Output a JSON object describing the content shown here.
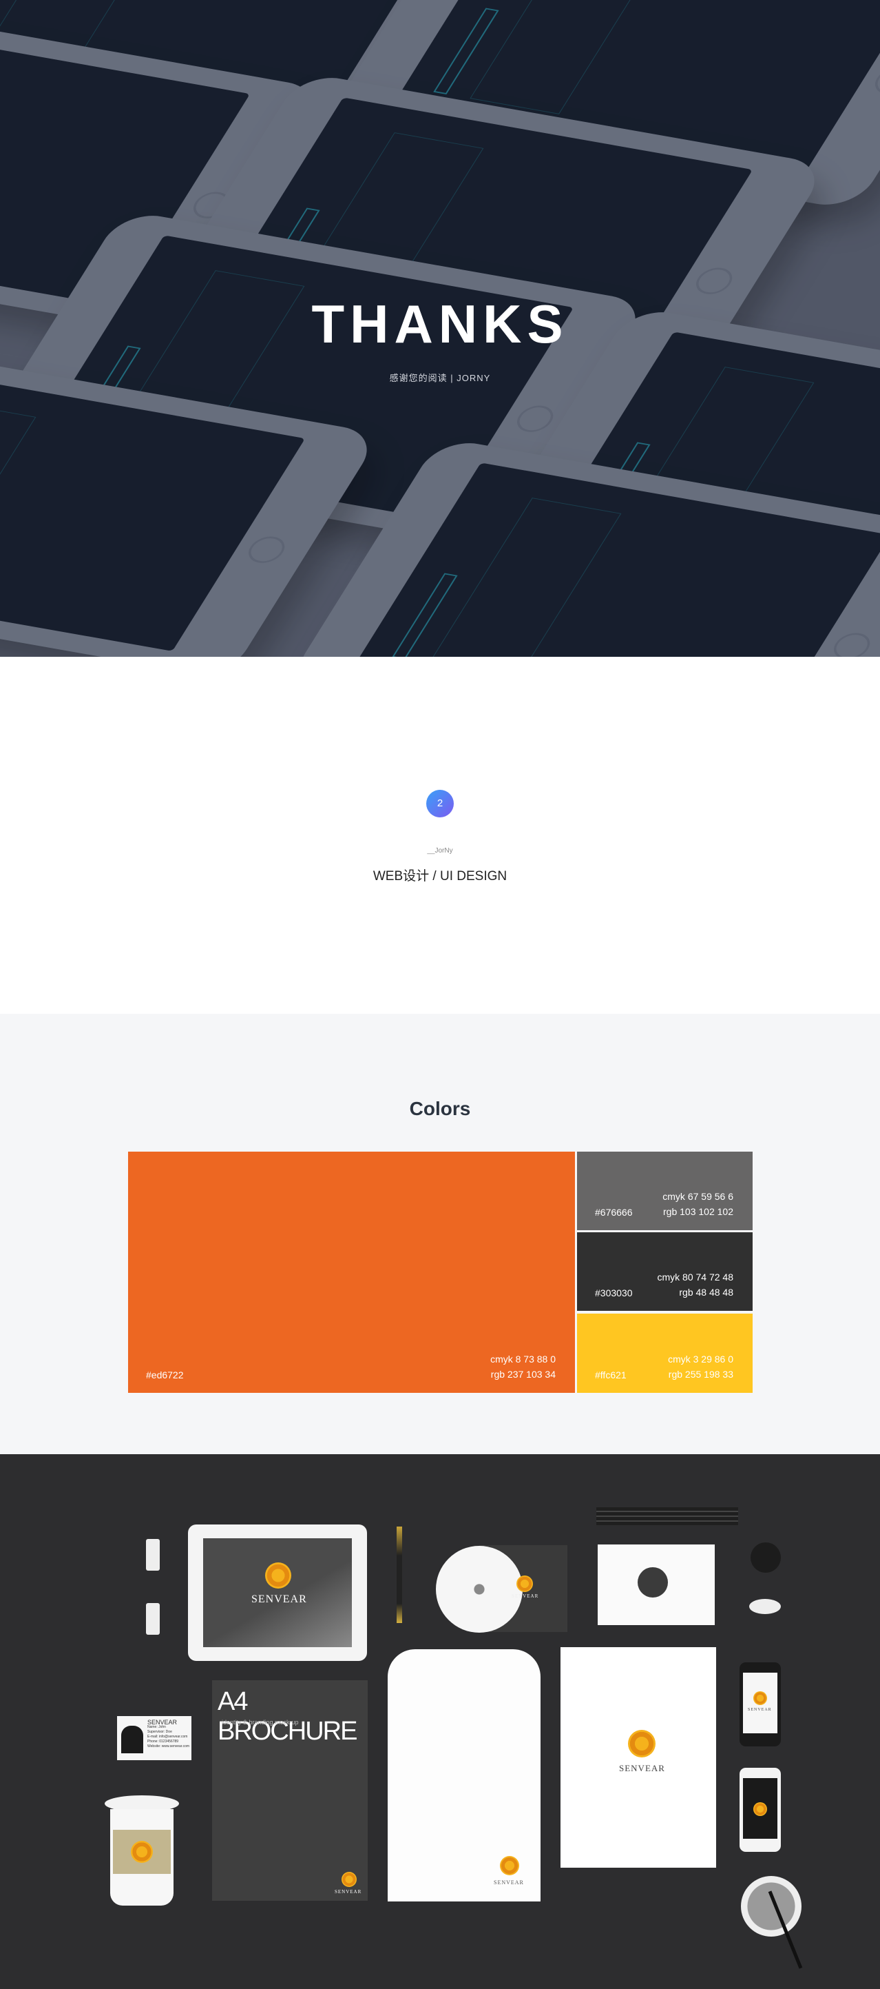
{
  "hero": {
    "title": "THANKS",
    "subtitle": "感谢您的阅读 | JORNY"
  },
  "section_marker": {
    "number": "2",
    "author": "__JorNy",
    "title": "WEB设计 / UI DESIGN"
  },
  "colors": {
    "title": "Colors",
    "swatches": [
      {
        "hex_label": "#ed6722",
        "cmyk": "cmyk  8 73 88 0",
        "rgb": "rgb 237 103 34",
        "color": "#ed6722"
      },
      {
        "hex_label": "#676666",
        "cmyk": "cmyk 67 59 56 6",
        "rgb": "rgb 103 102 102",
        "color": "#676666"
      },
      {
        "hex_label": "#303030",
        "cmyk": "cmyk 80 74 72 48",
        "rgb": "rgb 48 48 48",
        "color": "#303030"
      },
      {
        "hex_label": "#ffc621",
        "cmyk": "cmyk 3 29 86 0",
        "rgb": "rgb 255 198 33",
        "color": "#ffc621"
      }
    ]
  },
  "mockup": {
    "brand": "SENVEAR",
    "brochure_title": "A4 BROCHURE",
    "brochure_subtitle": "identity & branding mock-up",
    "id_card_lines": [
      "SENVEAR",
      "Name: John",
      "Supervisor: Doe",
      "E-mail: info@senvear.com",
      "Phone: 0123456789",
      "Website: www.senvear.com"
    ]
  }
}
